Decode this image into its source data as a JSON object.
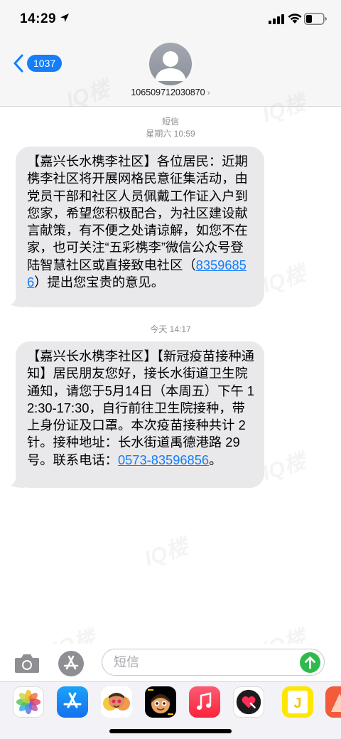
{
  "status_bar": {
    "time": "14:29"
  },
  "header": {
    "back_count": "1037",
    "contact": "106509712030870",
    "contact_chevron": "›"
  },
  "messages": [
    {
      "service": "短信",
      "timestamp": "星期六 10:59",
      "text_before": "【嘉兴长水槜李社区】各位居民：近期槜李社区将开展网格民意征集活动，由党员干部和社区人员佩戴工作证入户到您家，希望您积极配合，为社区建设献言献策，有不便之处请谅解，如您不在家，也可关注“五彩槜李”微信公众号登陆智慧社区或直接致电社区（",
      "link": "83596856",
      "text_after": "）提出您宝贵的意见。"
    },
    {
      "timestamp": "今天 14:17",
      "text_before": "【嘉兴长水槜李社区】【新冠疫苗接种通知】居民朋友您好，接长水街道卫生院通知，请您于5月14日（本周五）下午 12:30-17:30，自行前往卫生院接种，带上身份证及口罩。本次疫苗接种共计 2 针。接种地址：长水街道禹德港路 29 号。联系电话：",
      "link": "0573-83596856",
      "text_after": "。"
    }
  ],
  "compose": {
    "placeholder": "短信"
  },
  "app_drawer": {
    "apps": [
      "photos-icon",
      "app-store-icon",
      "memoji-icon",
      "animoji-icon",
      "music-icon",
      "digital-touch-icon",
      "j-app-icon",
      "more-app-icon"
    ]
  },
  "watermark": "IQ楼",
  "colors": {
    "ios_blue": "#147efb",
    "bubble_gray": "#e9e9eb",
    "send_green": "#30b94d"
  }
}
